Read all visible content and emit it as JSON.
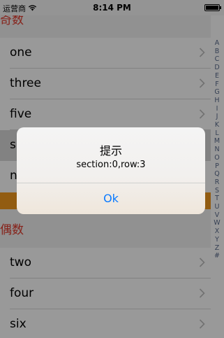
{
  "status_bar": {
    "carrier": "运营商",
    "time": "8:14 PM"
  },
  "sections": [
    {
      "title": "奇数",
      "rows": [
        {
          "label": "one"
        },
        {
          "label": "three"
        },
        {
          "label": "five"
        },
        {
          "label": "s"
        },
        {
          "label": "n"
        }
      ]
    },
    {
      "title": "偶数",
      "rows": [
        {
          "label": "two"
        },
        {
          "label": "four"
        },
        {
          "label": "six"
        }
      ]
    }
  ],
  "index_bar": [
    "A",
    "B",
    "C",
    "D",
    "E",
    "F",
    "G",
    "H",
    "I",
    "J",
    "K",
    "L",
    "M",
    "N",
    "O",
    "P",
    "Q",
    "R",
    "S",
    "T",
    "U",
    "V",
    "W",
    "X",
    "Y",
    "Z",
    "#"
  ],
  "alert": {
    "title": "提示",
    "message": "section:0,row:3",
    "button": "Ok"
  },
  "colors": {
    "section_header_text": "#e03a2c",
    "accent_band": "#f39a1d",
    "alert_button": "#0a7aff"
  }
}
